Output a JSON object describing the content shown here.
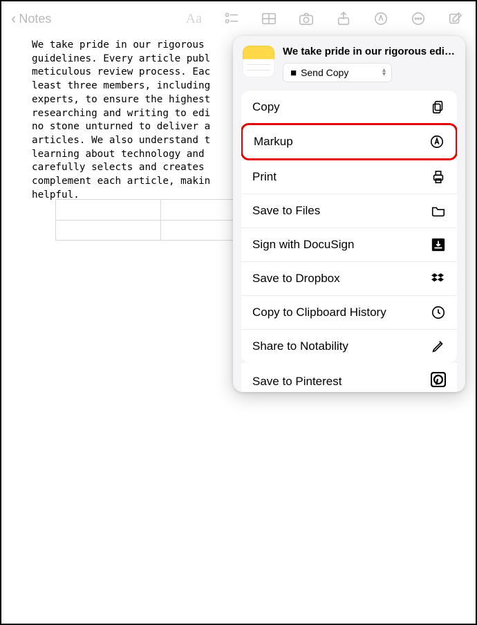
{
  "nav": {
    "back_label": "Notes"
  },
  "note": {
    "body": "We take pride in our rigorous\nguidelines. Every article publ\nmeticulous review process. Eac\nleast three members, including\nexperts, to ensure the highest\nresearching and writing to edi\nno stone unturned to deliver a\narticles. We also understand t\nlearning about technology and\ncarefully selects and creates\ncomplement each article, makin\nhelpful."
  },
  "share": {
    "title": "We take pride in our rigorous edit…",
    "send_copy_label": "Send Copy",
    "actions": [
      {
        "label": "Copy",
        "icon": "copy-icon",
        "highlight": false
      },
      {
        "label": "Markup",
        "icon": "markup-icon",
        "highlight": true
      },
      {
        "label": "Print",
        "icon": "print-icon",
        "highlight": false
      },
      {
        "label": "Save to Files",
        "icon": "folder-icon",
        "highlight": false
      },
      {
        "label": "Sign with DocuSign",
        "icon": "inbox-icon",
        "highlight": false
      },
      {
        "label": "Save to Dropbox",
        "icon": "dropbox-icon",
        "highlight": false
      },
      {
        "label": "Copy to Clipboard History",
        "icon": "history-icon",
        "highlight": false
      },
      {
        "label": "Share to Notability",
        "icon": "pencil-icon",
        "highlight": false
      },
      {
        "label": "Save to Pinterest",
        "icon": "pinterest-icon",
        "highlight": false
      }
    ]
  }
}
